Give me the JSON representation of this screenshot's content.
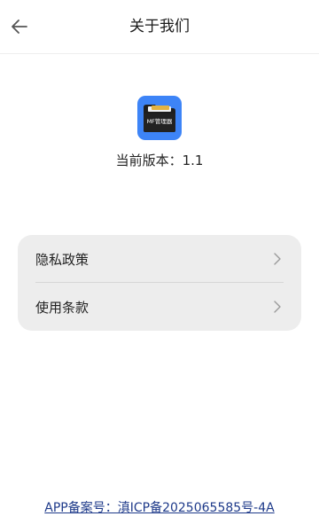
{
  "header": {
    "title": "关于我们",
    "back_icon": "arrow-left-icon"
  },
  "app": {
    "icon_text": "MF管理器",
    "icon_color": "#3d84f7",
    "version_text": "当前版本：1.1"
  },
  "menu": {
    "items": [
      {
        "label": "隐私政策",
        "icon": "chevron-right-icon"
      },
      {
        "label": "使用条款",
        "icon": "chevron-right-icon"
      }
    ]
  },
  "footer": {
    "icp_text": "APP备案号：滇ICP备2025065585号-4A",
    "link_color": "#1e3a8a"
  }
}
